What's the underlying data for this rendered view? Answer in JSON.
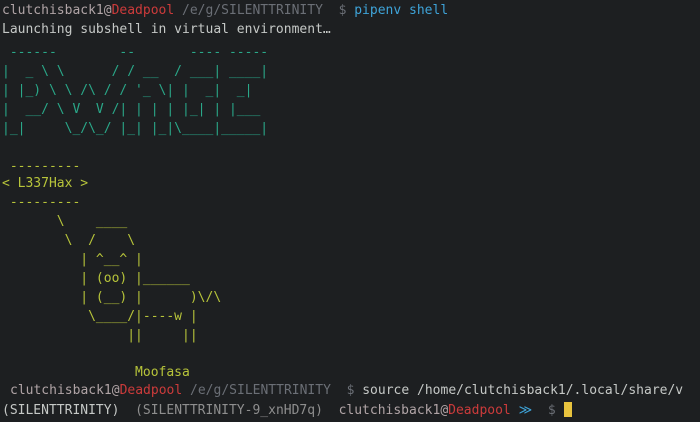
{
  "prompt1": {
    "user": "clutchisback1",
    "at": "@",
    "host": "Deadpool",
    "path": "/e/g/SILENTTRINITY",
    "symbol": "$",
    "cmd_part1": "pipenv",
    "cmd_part2": "shell"
  },
  "launch_message": "Launching subshell in virtual environment…",
  "banner_lines": [
    " ------        --       ---- -----",
    "|  _ \\ \\      / / __  / ___| ____|",
    "| |_) \\ \\ /\\ / / '_ \\| |  _|  _|",
    "|  __/ \\ V  V /| | | | |_| | |___",
    "|_|     \\_/\\_/ |_| |_|\\____|_____|"
  ],
  "cow_lines": [
    " ---------",
    "< L337Hax >",
    " ---------",
    "       \\    ____",
    "        \\  /    \\",
    "          | ^__^ |",
    "          | (oo) |______",
    "          | (__) |      )\\/\\",
    "           \\____/|----w |",
    "                ||     ||",
    "",
    "",
    "                 Moofasa"
  ],
  "prompt2": {
    "user": "clutchisback1",
    "at": "@",
    "host": "Deadpool",
    "path": "/e/g/SILENTTRINITY",
    "symbol": "$",
    "command": " source /home/clutchisback1/.local/share/v"
  },
  "prompt3": {
    "env1": "(SILENTTRINITY)",
    "env2": "(SILENTTRINITY-9_xnHD7q)",
    "user": "clutchisback1",
    "at": "@",
    "host": "Deadpool",
    "arrow": "≫",
    "symbol": "$"
  },
  "colors": {
    "background": "#1d1f21",
    "host": "#cc3b3b",
    "banner": "#2aa889",
    "cow": "#b7c43a",
    "command": "#3ea3d8",
    "cursor": "#e8c33e"
  }
}
